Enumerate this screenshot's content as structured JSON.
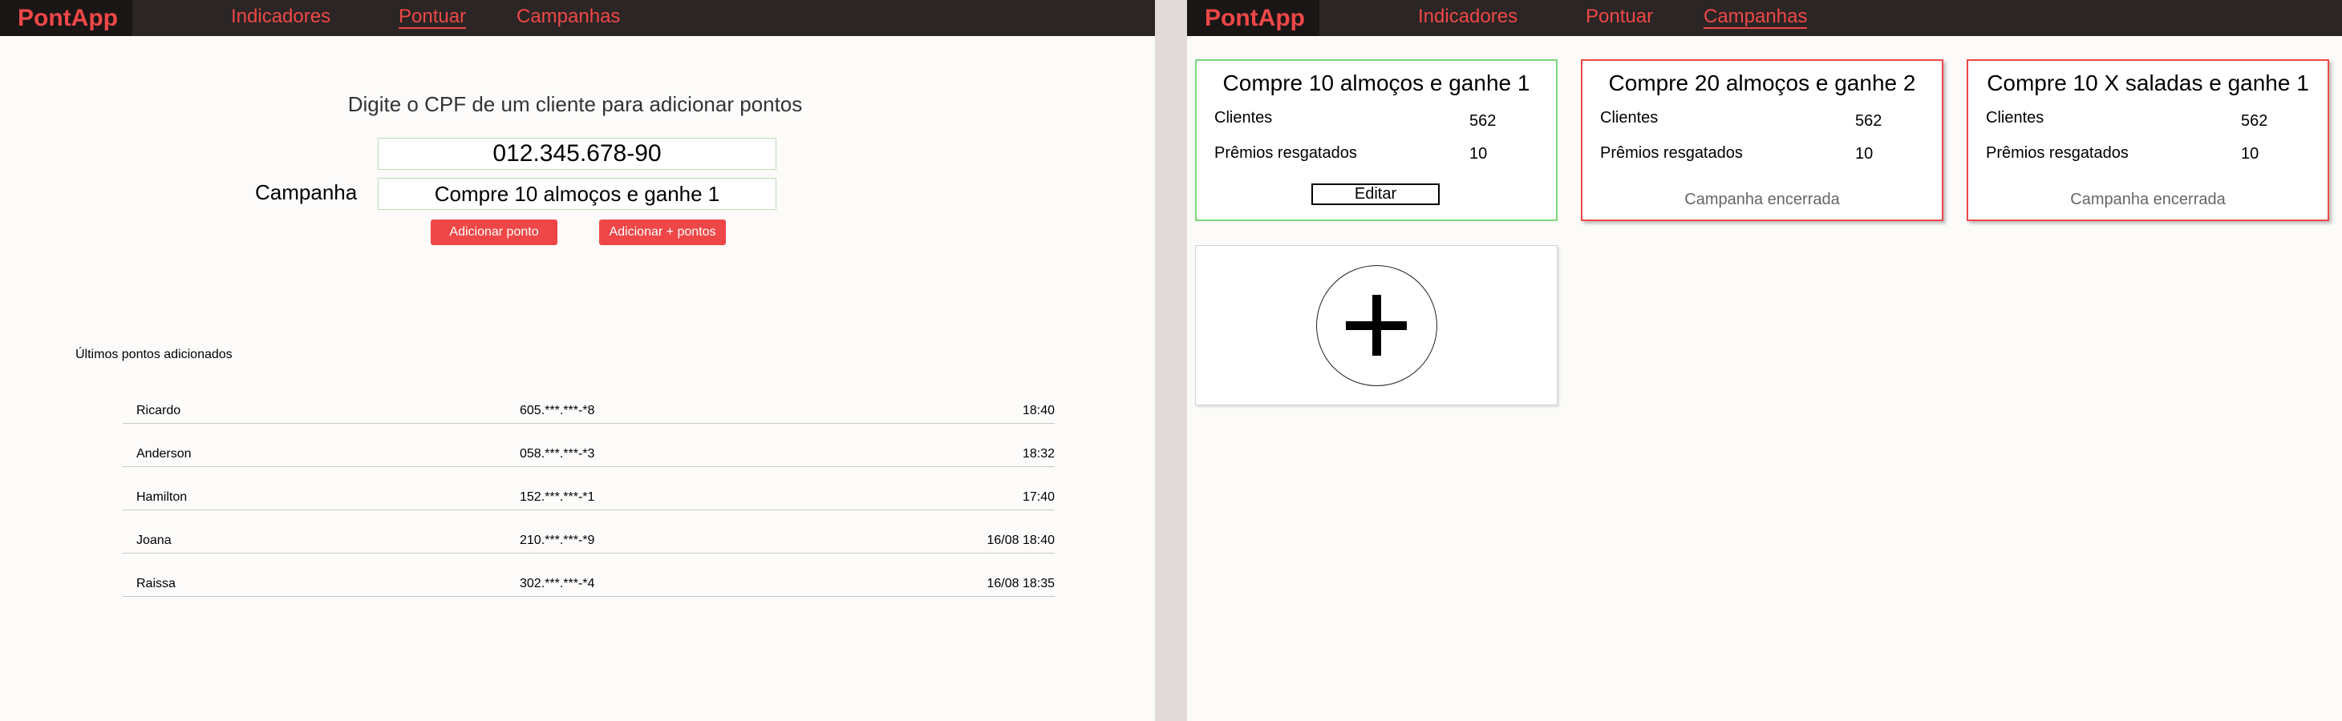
{
  "app": {
    "logo": "PontApp"
  },
  "nav": {
    "indicadores": "Indicadores",
    "pontuar": "Pontuar",
    "campanhas": "Campanhas"
  },
  "colors": {
    "accent": "#ef4747",
    "navbar": "#2c2525",
    "active_border": "#7cd77a"
  },
  "pontuar": {
    "heading": "Digite o CPF de um cliente para adicionar pontos",
    "cpf_value": "012.345.678-90",
    "campaign_label": "Campanha",
    "campaign_value": "Compre 10 almoços e ganhe 1",
    "add_one_button": "Adicionar ponto",
    "add_more_button": "Adicionar + pontos",
    "recent_title": "Últimos pontos adicionados",
    "recent": [
      {
        "name": "Ricardo",
        "cpf": "605.***.***-*8",
        "time": "18:40"
      },
      {
        "name": "Anderson",
        "cpf": "058.***.***-*3",
        "time": "18:32"
      },
      {
        "name": "Hamilton",
        "cpf": "152.***.***-*1",
        "time": "17:40"
      },
      {
        "name": "Joana",
        "cpf": "210.***.***-*9",
        "time": "16/08 18:40"
      },
      {
        "name": "Raissa",
        "cpf": "302.***.***-*4",
        "time": "16/08 18:35"
      }
    ]
  },
  "campanhas": {
    "cards": [
      {
        "title": "Compre 10 almoços e ganhe 1",
        "clients_label": "Clientes",
        "clients": "562",
        "prizes_label": "Prêmios resgatados",
        "prizes": "10",
        "action": "Editar",
        "status": "active"
      },
      {
        "title": "Compre 20 almoços e ganhe 2",
        "clients_label": "Clientes",
        "clients": "562",
        "prizes_label": "Prêmios resgatados",
        "prizes": "10",
        "footer": "Campanha encerrada",
        "status": "ended"
      },
      {
        "title": "Compre 10 X saladas e ganhe 1",
        "clients_label": "Clientes",
        "clients": "562",
        "prizes_label": "Prêmios resgatados",
        "prizes": "10",
        "footer": "Campanha encerrada",
        "status": "ended"
      }
    ],
    "add_icon": "plus-icon"
  }
}
